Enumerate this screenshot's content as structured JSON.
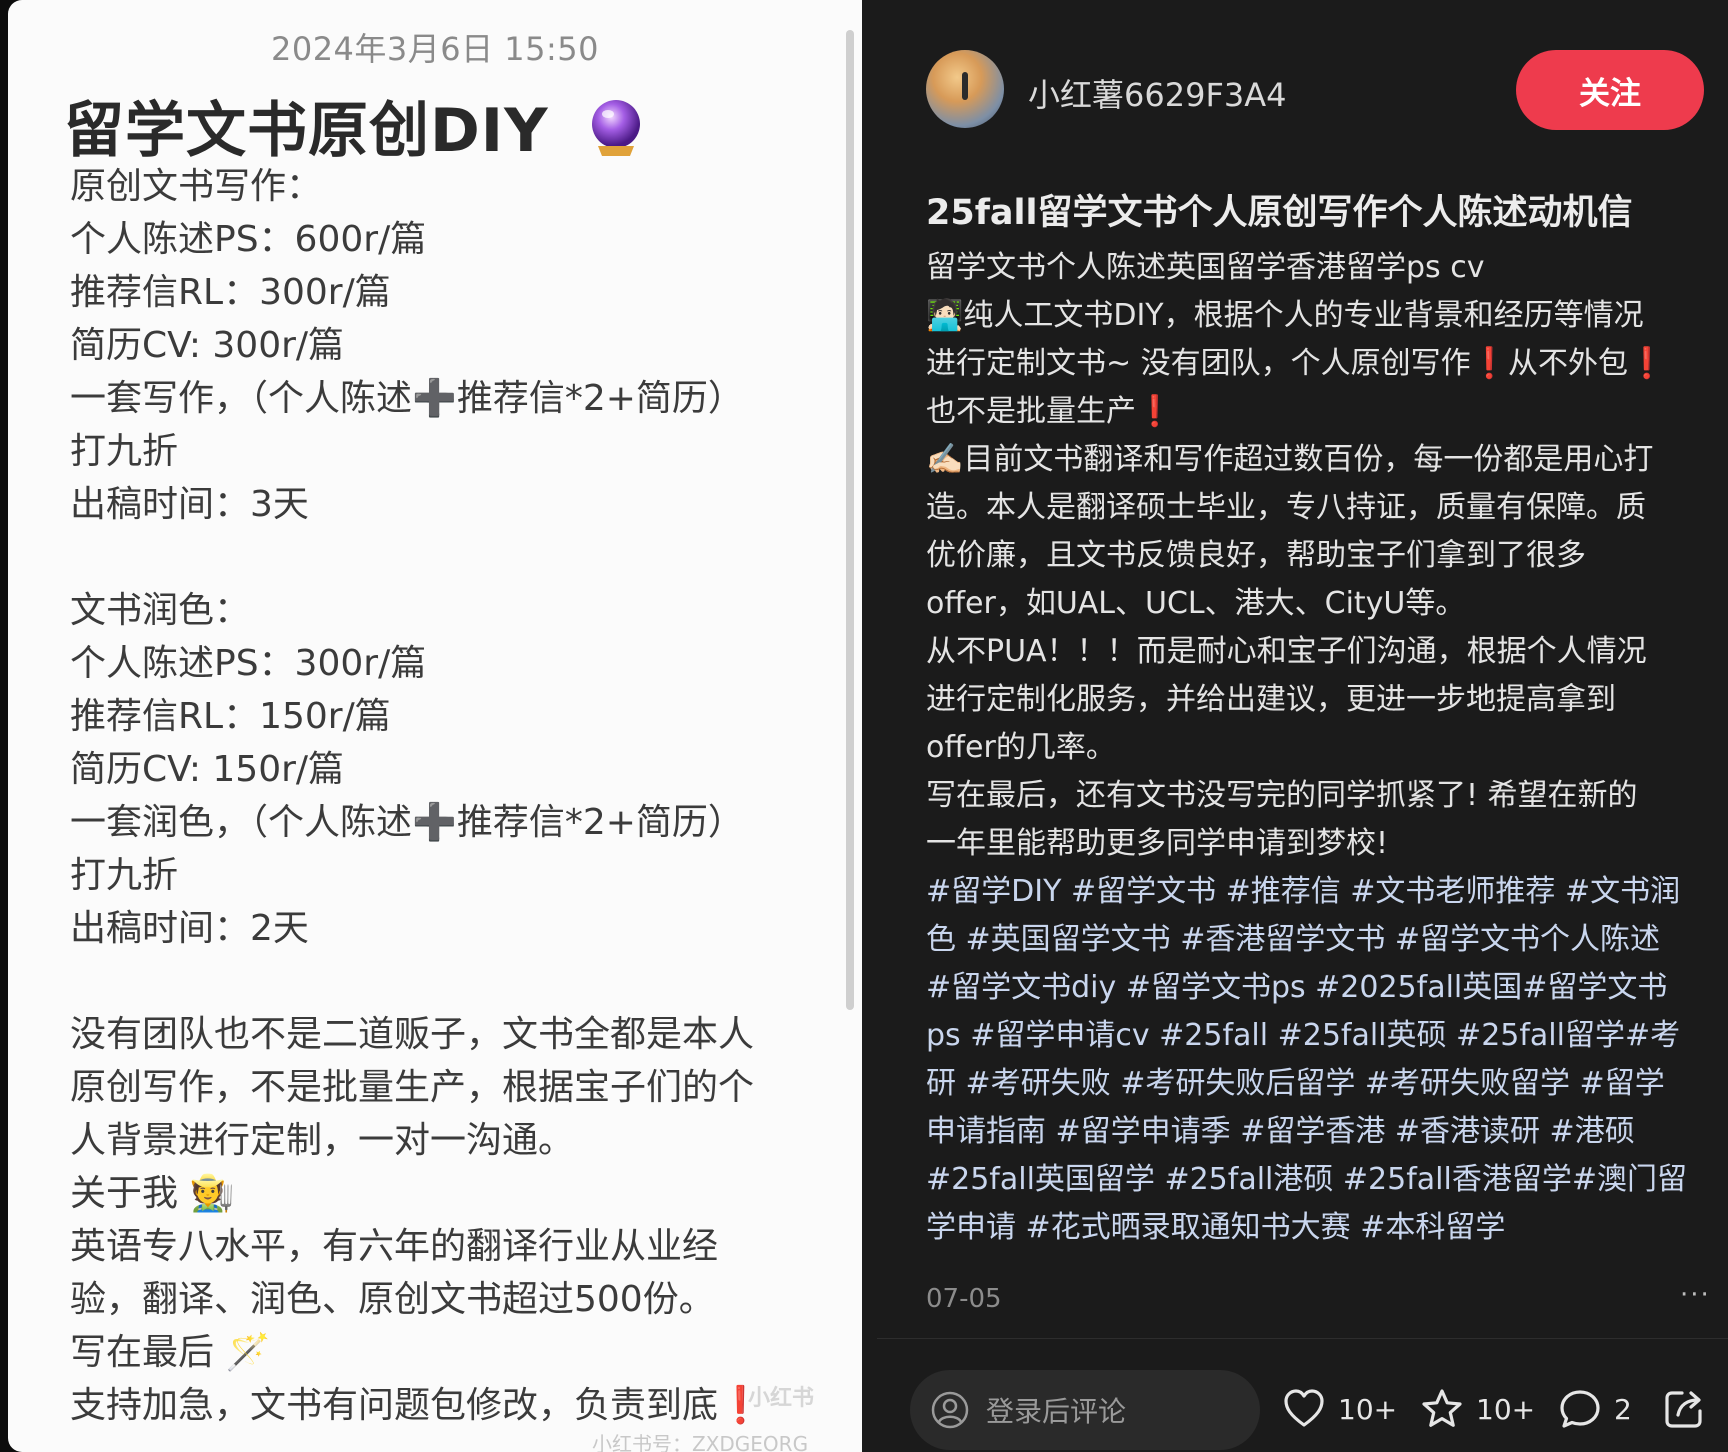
{
  "image_note": {
    "date": "2024年3月6日 15:50",
    "title": "留学文书原创DIY",
    "lines": [
      "原创文书写作：",
      "个人陈述PS：600r/篇",
      "推荐信RL：300r/篇",
      "简历CV: 300r/篇",
      "一套写作，（个人陈述➕推荐信*2+简历）",
      "打九折",
      "出稿时间：3天",
      "",
      "文书润色：",
      "个人陈述PS：300r/篇",
      "推荐信RL：150r/篇",
      "简历CV: 150r/篇",
      "一套润色，（个人陈述➕推荐信*2+简历）",
      "打九折",
      "出稿时间：2天",
      "",
      "没有团队也不是二道贩子，文书全都是本人",
      "原创写作，不是批量生产，根据宝子们的个",
      "人背景进行定制，一对一沟通。",
      "关于我 🧑‍🌾",
      "英语专八水平，有六年的翻译行业从业经",
      "验，翻译、润色、原创文书超过500份。",
      "写在最后 🪄",
      "支持加急，文书有问题包修改，负责到底❗"
    ],
    "watermark": "小红书号：ZXDGEORG",
    "watermark_logo": "小红书"
  },
  "author": {
    "username": "小红薯6629F3A4",
    "follow_label": "关注"
  },
  "note": {
    "title": "25fall留学文书个人原创写作个人陈述动机信",
    "body_lines": [
      {
        "text": "留学文书个人陈述英国留学香港留学ps cv"
      },
      {
        "text": "🧑🏻‍💻纯人工文书DIY，根据个人的专业背景和经历等情况"
      },
      {
        "text": "进行定制文书~ 没有团队，个人原创写作❗从不外包❗"
      },
      {
        "text": "也不是批量生产❗"
      },
      {
        "text": "✍🏻目前文书翻译和写作超过数百份，每一份都是用心打"
      },
      {
        "text": "造。本人是翻译硕士毕业，专八持证，质量有保障。质"
      },
      {
        "text": "优价廉，且文书反馈良好，帮助宝子们拿到了很多"
      },
      {
        "text": "offer，如UAL、UCL、港大、CityU等。"
      },
      {
        "text": "从不PUA！！！而是耐心和宝子们沟通，根据个人情况"
      },
      {
        "text": "进行定制化服务，并给出建议，更进一步地提高拿到"
      },
      {
        "text": "offer的几率。"
      },
      {
        "text": "写在最后，还有文书没写完的同学抓紧了! 希望在新的"
      },
      {
        "text": "一年里能帮助更多同学申请到梦校!"
      }
    ],
    "tag_lines": [
      "#留学DIY #留学文书 #推荐信 #文书老师推荐 #文书润",
      "色 #英国留学文书 #香港留学文书 #留学文书个人陈述",
      "#留学文书diy #留学文书ps #2025fall英国#留学文书",
      "ps #留学申请cv #25fall #25fall英硕 #25fall留学#考",
      "研 #考研失败 #考研失败后留学 #考研失败留学 #留学",
      "申请指南 #留学申请季 #留学香港 #香港读研 #港硕",
      "#25fall英国留学 #25fall港硕 #25fall香港留学#澳门留",
      "学申请 #花式晒录取通知书大赛  #本科留学"
    ],
    "date": "07-05",
    "more": "···"
  },
  "footer": {
    "comment_placeholder": "登录后评论",
    "likes": "10+",
    "collects": "10+",
    "comments": "2"
  },
  "colors": {
    "follow": "#ee3b4d",
    "detail_bg": "#1b1b1b",
    "image_bg": "#fbfbfb",
    "tag": "#c9d6ee"
  }
}
